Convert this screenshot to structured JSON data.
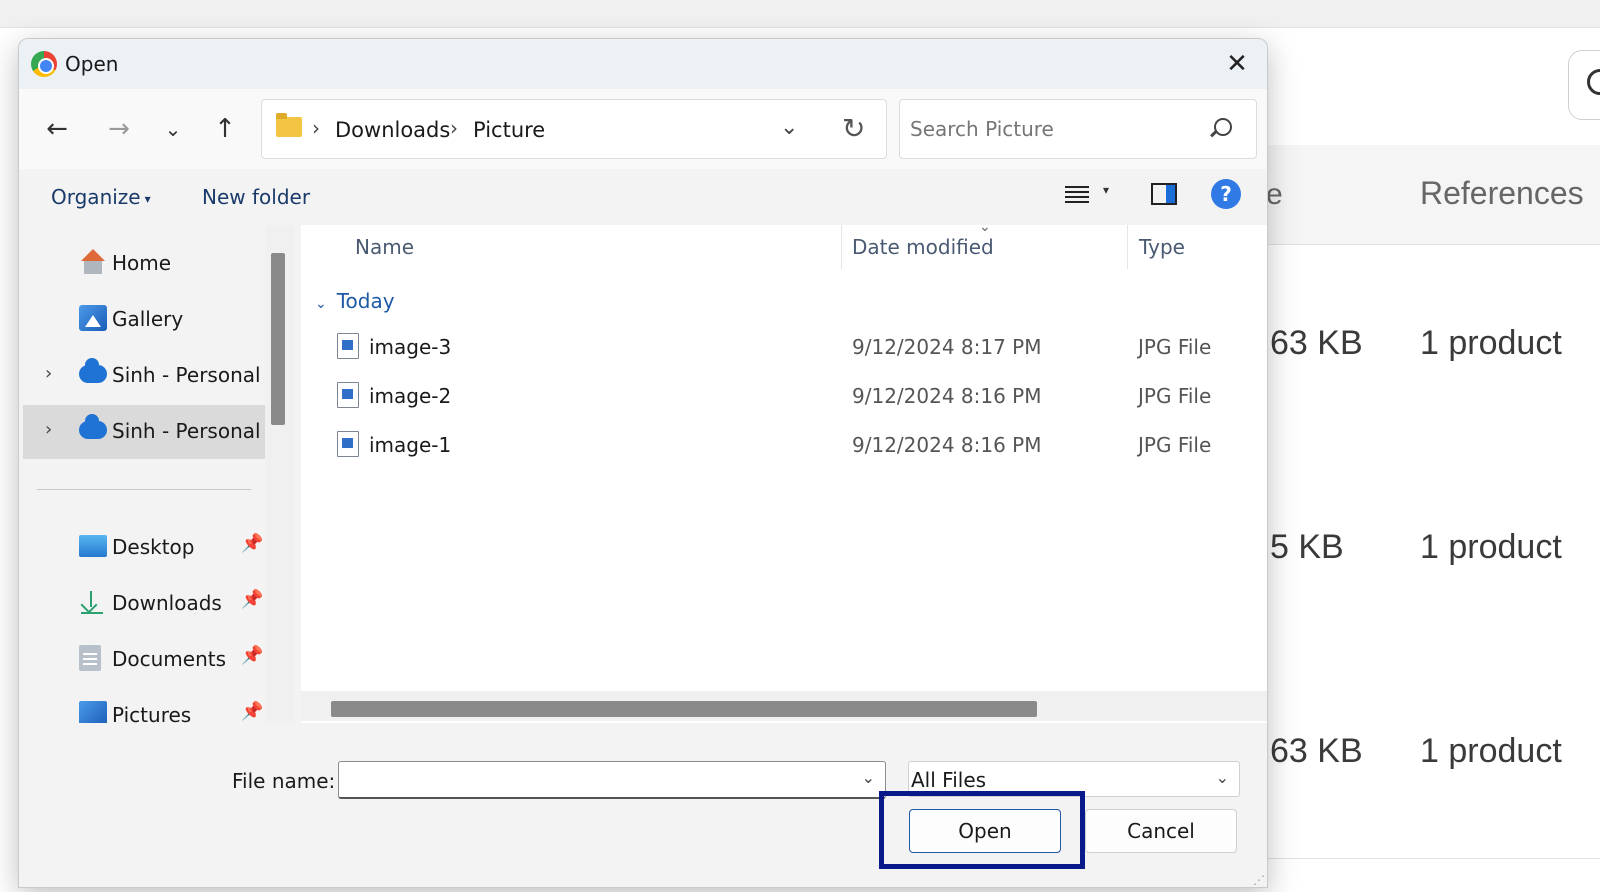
{
  "background": {
    "col_partial": "e",
    "col_references": "References",
    "rows": [
      {
        "size": "63 KB",
        "refs": "1 product"
      },
      {
        "size": "5 KB",
        "refs": "1 product"
      },
      {
        "size": "63 KB",
        "refs": "1 product"
      }
    ]
  },
  "dialog": {
    "title": "Open",
    "breadcrumb": [
      "Downloads",
      "Picture"
    ],
    "search_placeholder": "Search Picture",
    "commands": {
      "organize": "Organize",
      "new_folder": "New folder"
    },
    "nav_items": [
      {
        "label": "Home",
        "icon": "home-icon"
      },
      {
        "label": "Gallery",
        "icon": "gallery-icon"
      },
      {
        "label": "Sinh - Personal",
        "icon": "onedrive-icon"
      },
      {
        "label": "Sinh - Personal",
        "icon": "onedrive-icon"
      }
    ],
    "quick_access": [
      {
        "label": "Desktop",
        "icon": "desktop-icon"
      },
      {
        "label": "Downloads",
        "icon": "downloads-icon"
      },
      {
        "label": "Documents",
        "icon": "documents-icon"
      },
      {
        "label": "Pictures",
        "icon": "pictures-icon"
      }
    ],
    "columns": {
      "name": "Name",
      "date": "Date modified",
      "type": "Type"
    },
    "group": "Today",
    "files": [
      {
        "name": "image-3",
        "date": "9/12/2024 8:17 PM",
        "type": "JPG File"
      },
      {
        "name": "image-2",
        "date": "9/12/2024 8:16 PM",
        "type": "JPG File"
      },
      {
        "name": "image-1",
        "date": "9/12/2024 8:16 PM",
        "type": "JPG File"
      }
    ],
    "file_name_label": "File name:",
    "file_name_value": "",
    "file_type": "All Files",
    "open_label": "Open",
    "cancel_label": "Cancel"
  },
  "colors": {
    "accent": "#1f5aa6",
    "focus_outline": "#0a1a8a"
  }
}
